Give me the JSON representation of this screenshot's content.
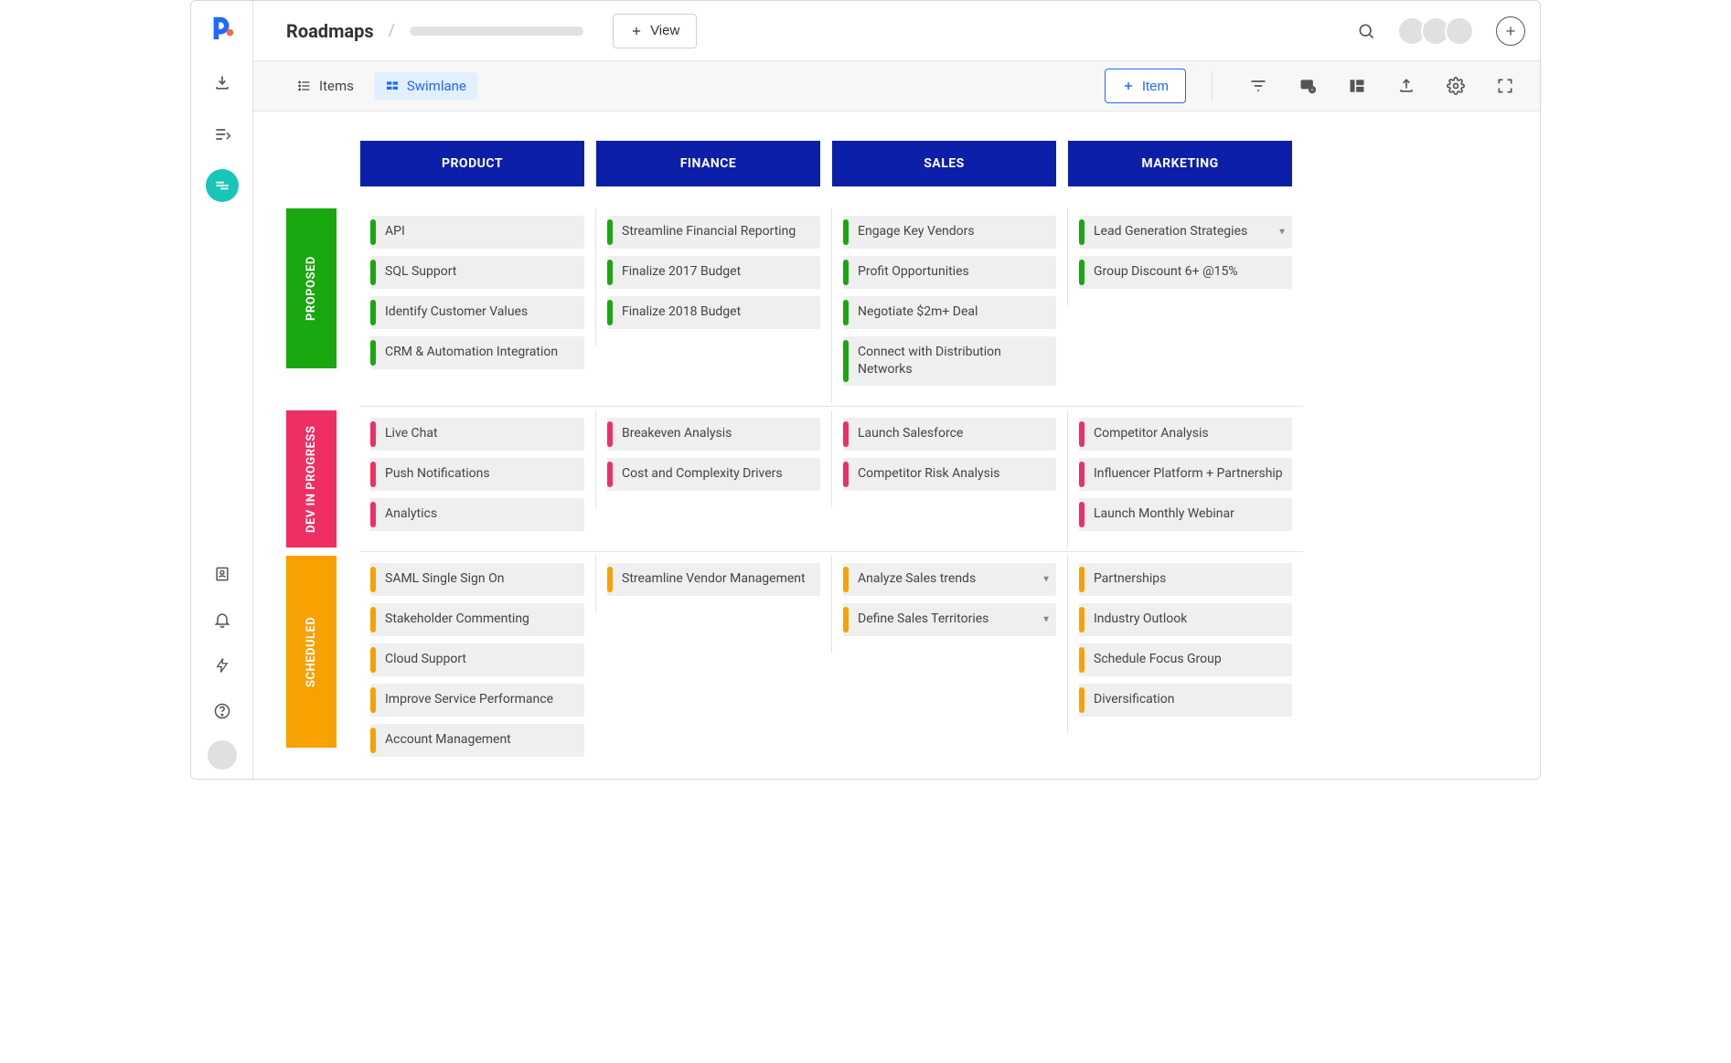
{
  "header": {
    "title": "Roadmaps",
    "view_button": "View",
    "add_aria": "Add"
  },
  "toolbar": {
    "items_label": "Items",
    "swimlane_label": "Swimlane",
    "item_button": "Item"
  },
  "columns": [
    "PRODUCT",
    "FINANCE",
    "SALES",
    "MARKETING"
  ],
  "rows": {
    "proposed": {
      "label": "PROPOSED",
      "stripe": "green",
      "cards": {
        "product": [
          "API",
          "SQL Support",
          "Identify Customer Values",
          "CRM & Automation Integration"
        ],
        "finance": [
          "Streamline Financial Reporting",
          "Finalize 2017 Budget",
          "Finalize 2018 Budget"
        ],
        "sales": [
          "Engage Key Vendors",
          "Profit Opportunities",
          "Negotiate $2m+ Deal",
          "Connect with Distribution Networks"
        ],
        "marketing": [
          "Lead Generation Strategies",
          "Group Discount 6+ @15%"
        ]
      }
    },
    "inprogress": {
      "label": "DEV IN PROGRESS",
      "stripe": "pink",
      "cards": {
        "product": [
          "Live Chat",
          "Push Notifications",
          "Analytics"
        ],
        "finance": [
          "Breakeven Analysis",
          "Cost and Complexity Drivers"
        ],
        "sales": [
          "Launch Salesforce",
          "Competitor Risk Analysis"
        ],
        "marketing": [
          "Competitor Analysis",
          "Influencer Platform + Partnership",
          "Launch Monthly Webinar"
        ]
      }
    },
    "scheduled": {
      "label": "SCHEDULED",
      "stripe": "orange",
      "cards": {
        "product": [
          "SAML Single Sign On",
          "Stakeholder Commenting",
          "Cloud Support",
          "Improve Service Performance",
          "Account Management"
        ],
        "finance": [
          "Streamline Vendor Management"
        ],
        "sales": [
          "Analyze Sales trends",
          "Define Sales Territories"
        ],
        "marketing": [
          "Partnerships",
          "Industry Outlook",
          "Schedule Focus Group",
          "Diversification"
        ]
      }
    }
  }
}
